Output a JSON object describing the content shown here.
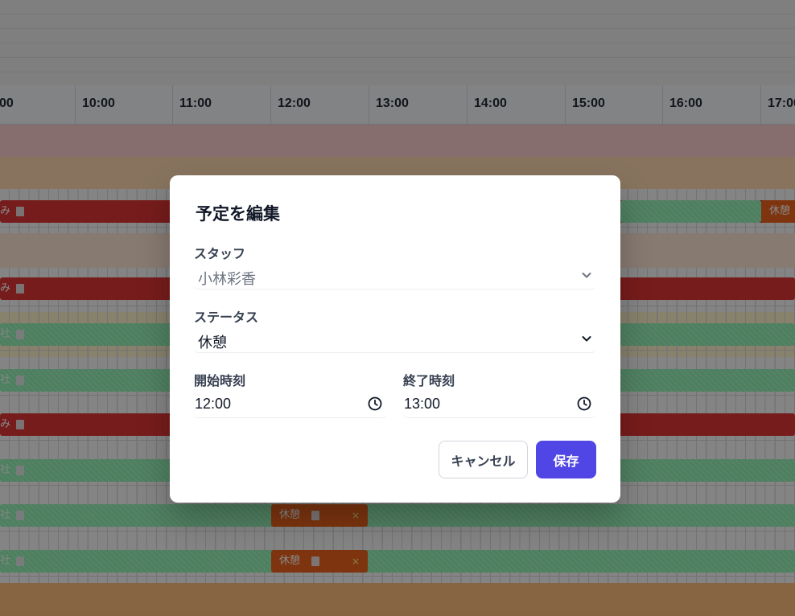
{
  "schedule": {
    "hours": [
      "00",
      "10:00",
      "11:00",
      "12:00",
      "13:00",
      "14:00",
      "15:00",
      "16:00",
      "17:00"
    ],
    "row_labels": {
      "row1": "み",
      "row1_right": "休憩",
      "row2": "み",
      "row3": "社",
      "row4": "社",
      "row5": "み",
      "row6": "社",
      "row7": "社",
      "row7_break": "休憩",
      "row8": "社",
      "row8_break": "休憩"
    },
    "close_glyph": "×"
  },
  "modal": {
    "title": "予定を編集",
    "staff_label": "スタッフ",
    "staff_value": "小林彩香",
    "status_label": "ステータス",
    "status_value": "休憩",
    "start_label": "開始時刻",
    "start_value": "12:00",
    "end_label": "終了時刻",
    "end_value": "13:00",
    "cancel_label": "キャンセル",
    "save_label": "保存"
  },
  "colors": {
    "accent": "#4f46e5",
    "red_bar": "#dc2626",
    "green_bar": "#86efac",
    "orange_bar": "#ea580c"
  },
  "icons": {
    "select_arrow": "chevron-down-icon",
    "time_picker": "clock-icon",
    "bar_note": "document-icon"
  }
}
